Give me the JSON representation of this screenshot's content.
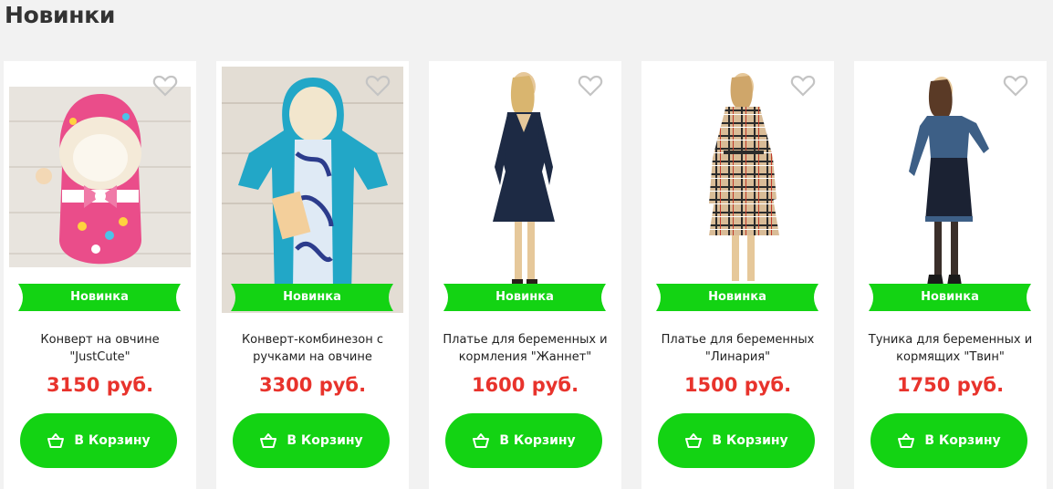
{
  "section": {
    "title": "Новинки"
  },
  "colors": {
    "accent": "#13d313",
    "price": "#e8332c"
  },
  "products": [
    {
      "badge": "Новинка",
      "name": "Конверт на овчине \"JustCute\"",
      "price": "3150 руб.",
      "cart_label": "В Корзину",
      "image": "pink-sheepskin-envelope"
    },
    {
      "badge": "Новинка",
      "name": "Конверт-комбинезон с ручками на овчине",
      "price": "3300 руб.",
      "cart_label": "В Корзину",
      "image": "turquoise-baby-overall"
    },
    {
      "badge": "Новинка",
      "name": "Платье для беременных и кормления \"Жаннет\"",
      "price": "1600 руб.",
      "cart_label": "В Корзину",
      "image": "navy-maternity-dress"
    },
    {
      "badge": "Новинка",
      "name": "Платье для беременных \"Линария\"",
      "price": "1500 руб.",
      "cart_label": "В Корзину",
      "image": "plaid-maternity-dress"
    },
    {
      "badge": "Новинка",
      "name": "Туника для беременных и кормящих \"Твин\"",
      "price": "1750 руб.",
      "cart_label": "В Корзину",
      "image": "blue-nursing-tunic"
    }
  ]
}
